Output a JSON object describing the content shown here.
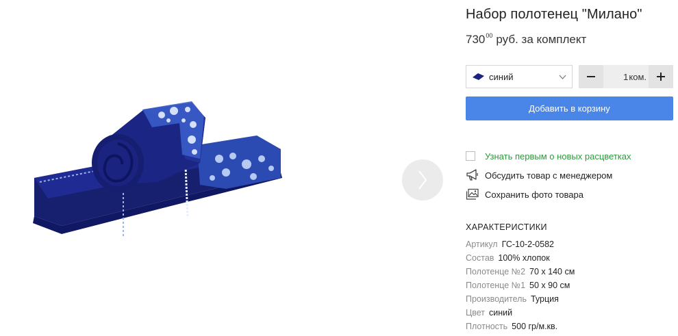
{
  "product": {
    "title": "Набор полотенец \"Милано\"",
    "price_main": "730",
    "price_cents": "00",
    "price_unit": "руб. за комплект"
  },
  "color_select": {
    "selected": "синий",
    "swatch_color": "#1a237e"
  },
  "quantity": {
    "value": "1",
    "unit": "ком.",
    "minus_label": "−",
    "plus_label": "+"
  },
  "buttons": {
    "add_to_cart": "Добавить в корзину"
  },
  "actions": [
    {
      "label": "Узнать первым о новых расцветках",
      "icon": "checkbox"
    },
    {
      "label": "Обсудить товар с менеджером",
      "icon": "megaphone-icon"
    },
    {
      "label": "Сохранить фото товара",
      "icon": "photo-icon"
    }
  ],
  "specs": {
    "title": "ХАРАКТЕРИСТИКИ",
    "rows": [
      {
        "key": "Артикул",
        "value": "ГС-10-2-0582"
      },
      {
        "key": "Состав",
        "value": "100% хлопок"
      },
      {
        "key": "Полотенце №2",
        "value": "70 х 140 см"
      },
      {
        "key": "Полотенце №1",
        "value": "50 х 90 см"
      },
      {
        "key": "Производитель",
        "value": "Турция"
      },
      {
        "key": "Цвет",
        "value": "синий"
      },
      {
        "key": "Плотность",
        "value": "500 гр/м.кв."
      }
    ]
  },
  "colors": {
    "accent": "#4a86e8",
    "notify_text": "#2a9a3a",
    "towel_dark": "#141c6b",
    "towel_mid": "#1e2a8f"
  }
}
